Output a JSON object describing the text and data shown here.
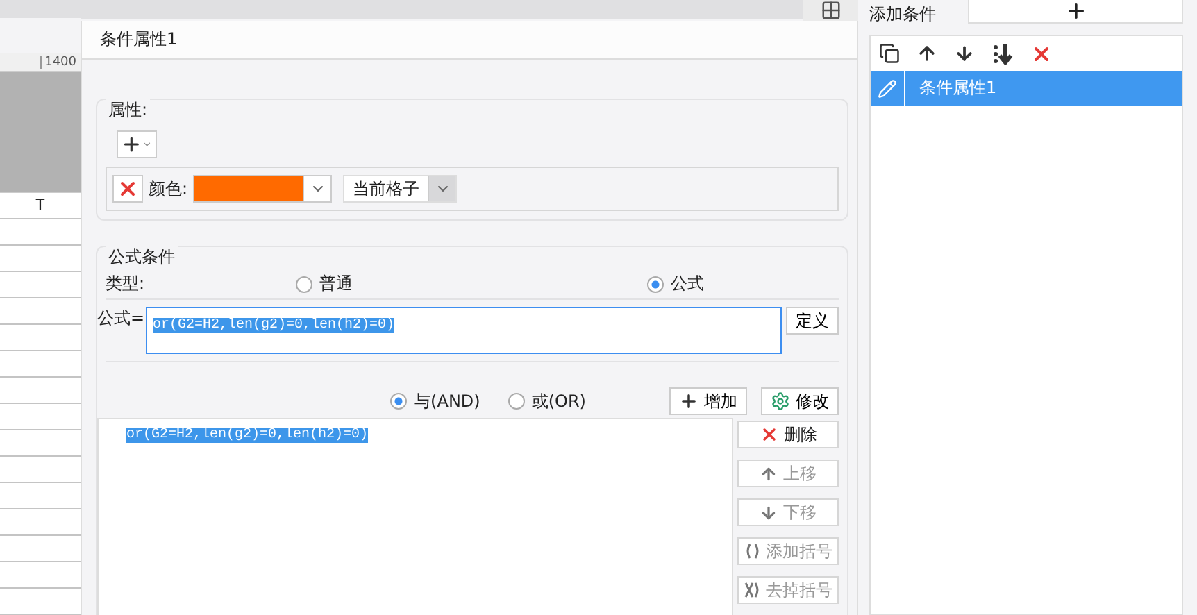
{
  "sheet": {
    "ruler_label": "1400",
    "column_header": "T"
  },
  "dialog": {
    "title": "条件属性1",
    "attributes": {
      "legend": "属性:",
      "property": {
        "label": "颜色:",
        "color": "#ff6a00",
        "scope": "当前格子"
      }
    },
    "formula_condition": {
      "legend": "公式条件",
      "type_label": "类型:",
      "types": [
        {
          "label": "普通",
          "selected": false
        },
        {
          "label": "公式",
          "selected": true
        }
      ],
      "formula_label": "公式=",
      "formula": "or(G2=H2,len(g2)=0,len(h2)=0)",
      "define_button": "定义",
      "logic": [
        {
          "label": "与(AND)",
          "selected": true
        },
        {
          "label": "或(OR)",
          "selected": false
        }
      ],
      "add_button": "增加",
      "modify_button": "修改",
      "conditions": [
        {
          "text": "or(G2=H2,len(g2)=0,len(h2)=0)",
          "selected": true
        }
      ],
      "side_buttons": [
        {
          "kind": "delete",
          "label": "删除",
          "disabled": false
        },
        {
          "kind": "up",
          "label": "上移",
          "disabled": true
        },
        {
          "kind": "down",
          "label": "下移",
          "disabled": true
        },
        {
          "kind": "add-brackets",
          "label": "添加括号",
          "disabled": true
        },
        {
          "kind": "remove-brackets",
          "label": "去掉括号",
          "disabled": true
        }
      ]
    }
  },
  "conditions_panel": {
    "title": "添加条件",
    "items": [
      {
        "label": "条件属性1",
        "selected": true
      }
    ]
  }
}
